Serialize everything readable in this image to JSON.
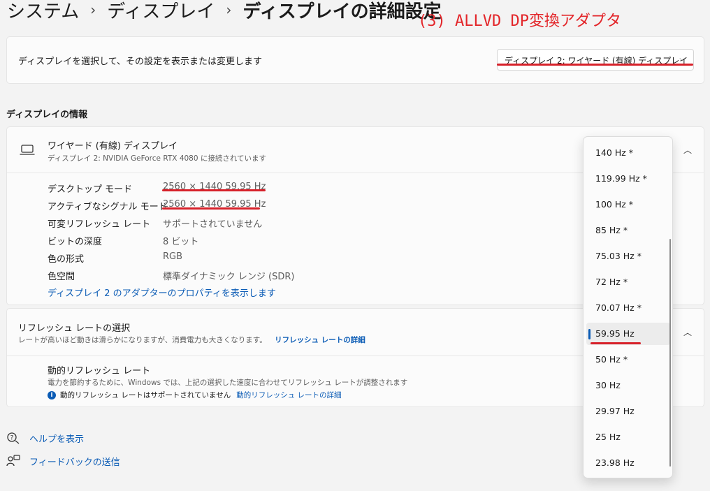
{
  "breadcrumb": {
    "items": [
      "システム",
      "ディスプレイ"
    ],
    "current": "ディスプレイの詳細設定"
  },
  "annotation": "(3) ALLVD DP変換アダプタ",
  "select_card": {
    "description": "ディスプレイを選択して、その設定を表示または変更します",
    "selected_display": "ディスプレイ 2: ワイヤード (有線) ディスプレイ"
  },
  "display_info": {
    "section_title": "ディスプレイの情報",
    "title": "ワイヤード (有線) ディスプレイ",
    "subtitle": "ディスプレイ 2: NVIDIA GeForce RTX 4080 に接続されています",
    "properties": [
      {
        "label": "デスクトップ モード",
        "value": "2560 × 1440 59.95 Hz"
      },
      {
        "label": "アクティブなシグナル モード",
        "value": "2560 × 1440 59.95 Hz"
      },
      {
        "label": "可変リフレッシュ レート",
        "value": "サポートされていません"
      },
      {
        "label": "ビットの深度",
        "value": "8 ビット"
      },
      {
        "label": "色の形式",
        "value": "RGB"
      },
      {
        "label": "色空間",
        "value": "標準ダイナミック レンジ (SDR)"
      }
    ],
    "adapter_link": "ディスプレイ 2 のアダプターのプロパティを表示します"
  },
  "refresh": {
    "title": "リフレッシュ レートの選択",
    "subtitle": "レートが高いほど動きは滑らかになりますが、消費電力も大きくなります。",
    "subtitle_link": "リフレッシュ レートの詳細",
    "dynamic_title": "動的リフレッシュ レート",
    "dynamic_subtitle": "電力を節約するために、Windows では、上記の選択した速度に合わせてリフレッシュ レートが調整されます",
    "dynamic_note": "動的リフレッシュ レートはサポートされていません",
    "dynamic_link": "動的リフレッシュ レートの詳細"
  },
  "refresh_options": [
    "140 Hz *",
    "119.99 Hz *",
    "100 Hz *",
    "85 Hz *",
    "75.03 Hz *",
    "72 Hz *",
    "70.07 Hz *",
    "59.95 Hz",
    "50 Hz *",
    "30 Hz",
    "29.97 Hz",
    "25 Hz",
    "23.98 Hz"
  ],
  "selected_refresh": "59.95 Hz",
  "footer": {
    "help": "ヘルプを表示",
    "feedback": "フィードバックの送信"
  },
  "colors": {
    "accent": "#0a5bb5",
    "annotation_red": "#e3262a"
  }
}
